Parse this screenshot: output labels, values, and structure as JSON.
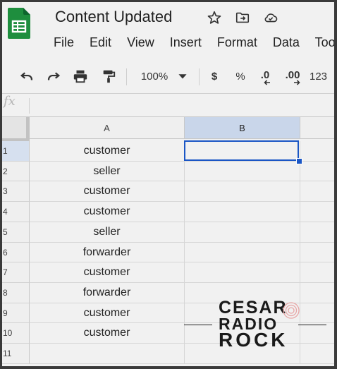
{
  "app": {
    "title": "Content Updated"
  },
  "header_icons": [
    "star-icon",
    "move-to-folder-icon",
    "cloud-saved-icon"
  ],
  "menu": [
    "File",
    "Edit",
    "View",
    "Insert",
    "Format",
    "Data",
    "Too"
  ],
  "toolbar": {
    "zoom": "100%",
    "currency": "$",
    "percent": "%",
    "decrease_decimals": ".0",
    "increase_decimals": ".00",
    "more_formats": "123"
  },
  "formula_bar": {
    "fx_label": "fx"
  },
  "columns": [
    "A",
    "B"
  ],
  "rows": [
    {
      "num": "1",
      "a": "customer",
      "b": ""
    },
    {
      "num": "2",
      "a": "seller",
      "b": ""
    },
    {
      "num": "3",
      "a": "customer",
      "b": ""
    },
    {
      "num": "4",
      "a": "customer",
      "b": ""
    },
    {
      "num": "5",
      "a": "seller",
      "b": ""
    },
    {
      "num": "6",
      "a": "forwarder",
      "b": ""
    },
    {
      "num": "7",
      "a": "customer",
      "b": ""
    },
    {
      "num": "8",
      "a": "forwarder",
      "b": ""
    },
    {
      "num": "9",
      "a": "customer",
      "b": ""
    },
    {
      "num": "10",
      "a": "customer",
      "b": ""
    },
    {
      "num": "11",
      "a": "",
      "b": ""
    }
  ],
  "selected_cell": "B1",
  "watermark": {
    "line1": "CESAR",
    "line2": "RADIO",
    "line3": "ROCK"
  },
  "colors": {
    "accent": "#1a56c5",
    "logo_green": "#1e8e3e"
  }
}
